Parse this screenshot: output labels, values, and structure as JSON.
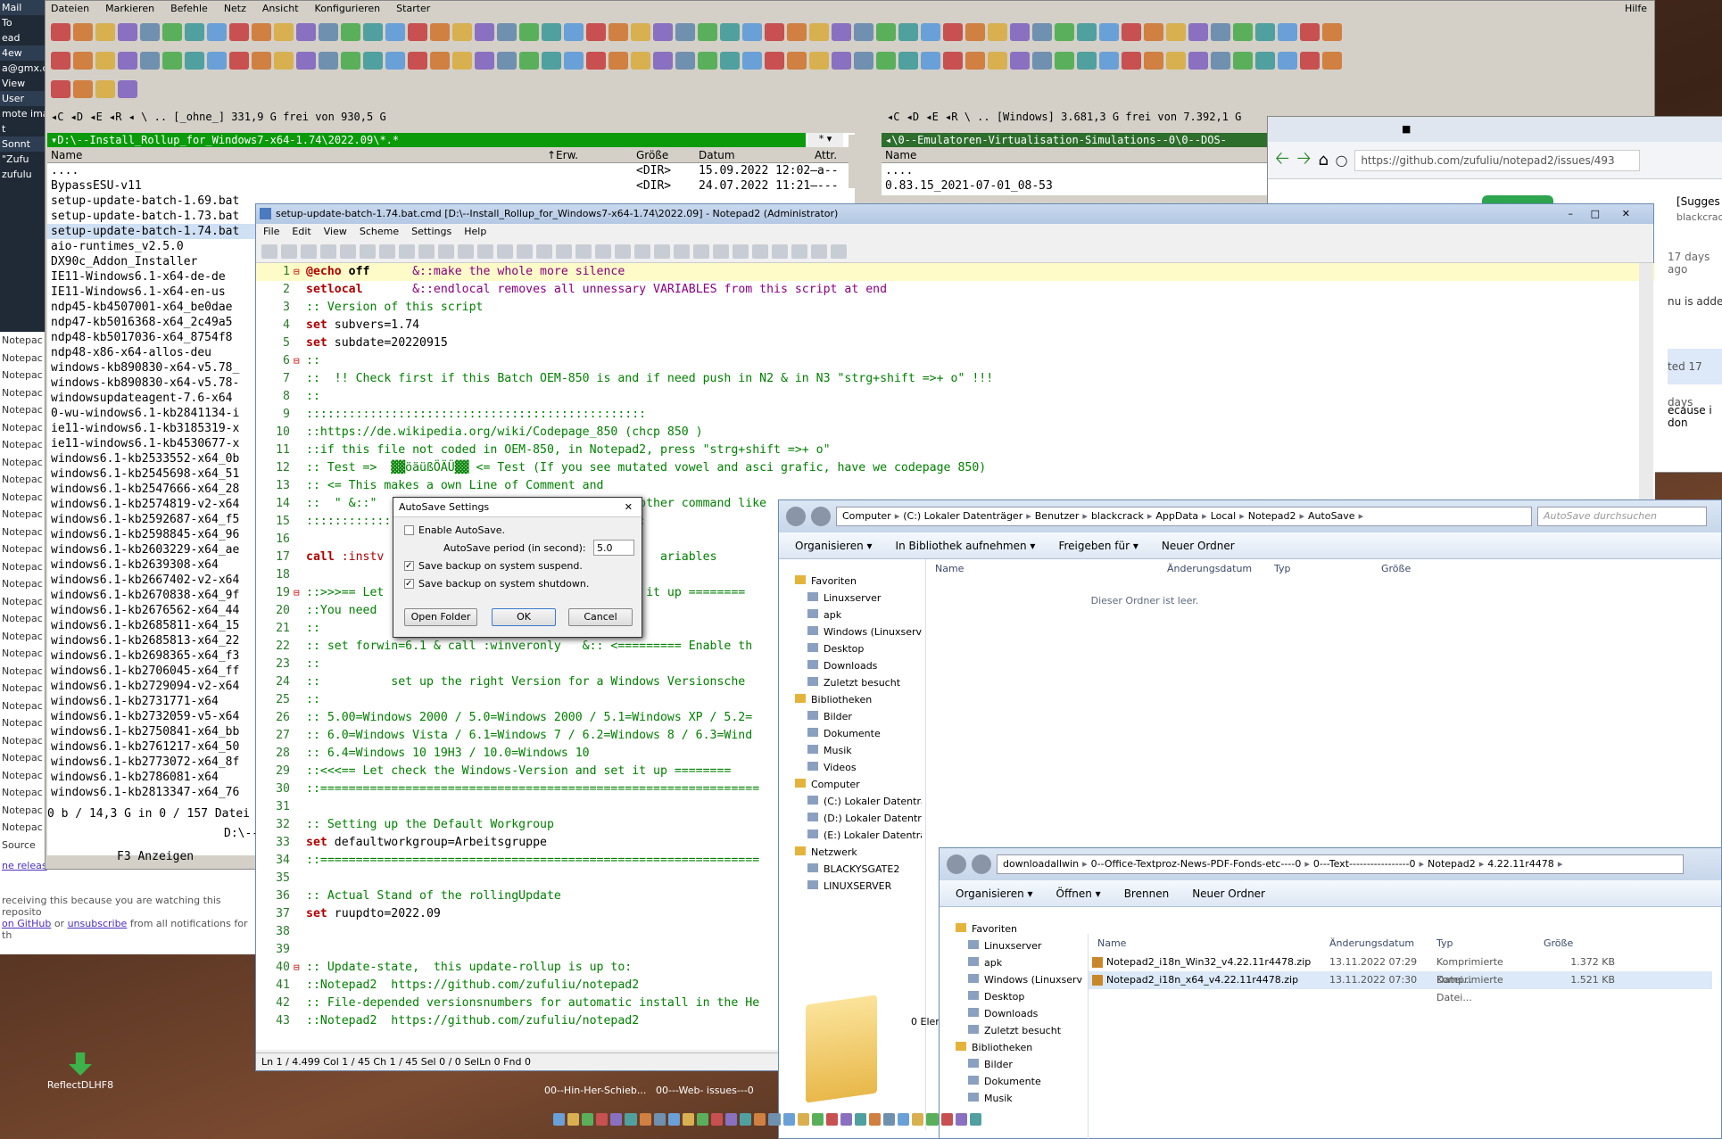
{
  "left_sliver": {
    "items": [
      "Mail",
      "To",
      "ead",
      "4ew",
      "a@gmx.c",
      "View",
      "User",
      "mote ima",
      "t",
      "Sonnt",
      "\"Zufu",
      "zufulu"
    ],
    "notepad_items": [
      "Notepac",
      "Notepac",
      "Notepac",
      "Notepac",
      "Notepac",
      "Notepac",
      "Notepac",
      "Notepac",
      "Notepac",
      "Notepac",
      "Notepac",
      "Notepac",
      "Notepac",
      "Notepac",
      "Notepac",
      "Notepac",
      "Notepac",
      "Notepac",
      "Notepac",
      "Notepac",
      "Notepac",
      "Notepac",
      "Notepac",
      "Notepac",
      "Notepac",
      "Notepac",
      "Notepac",
      "Notepac",
      "Notepac",
      "Source",
      "Source"
    ]
  },
  "tc": {
    "menu": [
      "Dateien",
      "Markieren",
      "Befehle",
      "Netz",
      "Ansicht",
      "Konfigurieren",
      "Starter"
    ],
    "help": "Hilfe",
    "drives_left": "◂C ◂D ◂E ◂R ◂ \\ .. [_ohne_]  331,9 G frei von 930,5 G",
    "drives_right": "◂C ◂D ◂E ◂R \\ .. [Windows]  3.681,3 G frei von 7.392,1 G",
    "left_path": "▾D:\\--Install_Rollup_for_Windows7-x64-1.74\\2022.09\\*.*",
    "left_star": "* ▾",
    "right_path": "◂\\0--Emulatoren-Virtualisation-Simulations--0\\0--DOS-",
    "cols": {
      "name": "Name",
      "ext": "↑Erw.",
      "size": "Größe",
      "date": "Datum",
      "attr": "Attr."
    },
    "left_files": [
      {
        "name": "....",
        "size": "<DIR>",
        "date": "15.09.2022 12:02—a--"
      },
      {
        "name": "BypassESU-v11",
        "size": "<DIR>",
        "date": "24.07.2022 11:21—---"
      },
      {
        "name": "setup-update-batch-1.69.bat",
        "size": "",
        "date": ""
      },
      {
        "name": "setup-update-batch-1.73.bat",
        "size": "",
        "date": ""
      },
      {
        "name": "setup-update-batch-1.74.bat",
        "size": "",
        "date": ""
      },
      {
        "name": "aio-runtimes_v2.5.0",
        "size": "",
        "date": ""
      },
      {
        "name": "DX90c_Addon_Installer",
        "size": "",
        "date": ""
      },
      {
        "name": "IE11-Windows6.1-x64-de-de",
        "size": "",
        "date": ""
      },
      {
        "name": "IE11-Windows6.1-x64-en-us",
        "size": "",
        "date": ""
      },
      {
        "name": "ndp45-kb4507001-x64_be0dae",
        "size": "",
        "date": ""
      },
      {
        "name": "ndp47-kb5016368-x64_2c49a5",
        "size": "",
        "date": ""
      },
      {
        "name": "ndp48-kb5017036-x64_8754f8",
        "size": "",
        "date": ""
      },
      {
        "name": "ndp48-x86-x64-allos-deu",
        "size": "",
        "date": ""
      },
      {
        "name": "windows-kb890830-x64-v5.78_",
        "size": "",
        "date": ""
      },
      {
        "name": "windows-kb890830-x64-v5.78-",
        "size": "",
        "date": ""
      },
      {
        "name": "windowsupdateagent-7.6-x64",
        "size": "",
        "date": ""
      },
      {
        "name": "0-wu-windows6.1-kb2841134-i",
        "size": "",
        "date": ""
      },
      {
        "name": "ie11-windows6.1-kb3185319-x",
        "size": "",
        "date": ""
      },
      {
        "name": "ie11-windows6.1-kb4530677-x",
        "size": "",
        "date": ""
      },
      {
        "name": "windows6.1-kb2533552-x64_0b",
        "size": "",
        "date": ""
      },
      {
        "name": "windows6.1-kb2545698-x64_51",
        "size": "",
        "date": ""
      },
      {
        "name": "windows6.1-kb2547666-x64_28",
        "size": "",
        "date": ""
      },
      {
        "name": "windows6.1-kb2574819-v2-x64",
        "size": "",
        "date": ""
      },
      {
        "name": "windows6.1-kb2592687-x64_f5",
        "size": "",
        "date": ""
      },
      {
        "name": "windows6.1-kb2598845-x64_96",
        "size": "",
        "date": ""
      },
      {
        "name": "windows6.1-kb2603229-x64_ae",
        "size": "",
        "date": ""
      },
      {
        "name": "windows6.1-kb2639308-x64",
        "size": "",
        "date": ""
      },
      {
        "name": "windows6.1-kb2667402-v2-x64",
        "size": "",
        "date": ""
      },
      {
        "name": "windows6.1-kb2670838-x64_9f",
        "size": "",
        "date": ""
      },
      {
        "name": "windows6.1-kb2676562-x64_44",
        "size": "",
        "date": ""
      },
      {
        "name": "windows6.1-kb2685811-x64_15",
        "size": "",
        "date": ""
      },
      {
        "name": "windows6.1-kb2685813-x64_22",
        "size": "",
        "date": ""
      },
      {
        "name": "windows6.1-kb2698365-x64_f3",
        "size": "",
        "date": ""
      },
      {
        "name": "windows6.1-kb2706045-x64_ff",
        "size": "",
        "date": ""
      },
      {
        "name": "windows6.1-kb2729094-v2-x64",
        "size": "",
        "date": ""
      },
      {
        "name": "windows6.1-kb2731771-x64",
        "size": "",
        "date": ""
      },
      {
        "name": "windows6.1-kb2732059-v5-x64",
        "size": "",
        "date": ""
      },
      {
        "name": "windows6.1-kb2750841-x64_bb",
        "size": "",
        "date": ""
      },
      {
        "name": "windows6.1-kb2761217-x64_50",
        "size": "",
        "date": ""
      },
      {
        "name": "windows6.1-kb2773072-x64_8f",
        "size": "",
        "date": ""
      },
      {
        "name": "windows6.1-kb2786081-x64",
        "size": "",
        "date": ""
      },
      {
        "name": "windows6.1-kb2813347-x64_76",
        "size": "",
        "date": ""
      }
    ],
    "right_files": [
      {
        "name": "....",
        "size": "",
        "date": ""
      },
      {
        "name": "0.83.15_2021-07-01_08-53",
        "size": "",
        "date": ""
      }
    ],
    "left_status": "0 b / 14,3 G in 0 / 157 Datei",
    "cmdline": "D:\\--",
    "f3": "F3 Anzeigen"
  },
  "notepad": {
    "title": "setup-update-batch-1.74.bat.cmd [D:\\--Install_Rollup_for_Windows7-x64-1.74\\2022.09] - Notepad2 (Administrator)",
    "menu": [
      "File",
      "Edit",
      "View",
      "Scheme",
      "Settings",
      "Help"
    ],
    "lines": [
      {
        "n": "1",
        "fold": "⊟",
        "parts": [
          {
            "t": "@echo",
            "c": "#b00000",
            "b": true
          },
          {
            "t": " off",
            "c": "#000",
            "b": true
          },
          {
            "t": "      &::make the whole more silence",
            "c": "#8a0080"
          }
        ],
        "hl": true
      },
      {
        "n": "2",
        "parts": [
          {
            "t": "setlocal",
            "c": "#b00000",
            "b": true
          },
          {
            "t": "       &::endlocal removes all unnessary VARIABLES from this script at end",
            "c": "#8a0080"
          }
        ]
      },
      {
        "n": "3",
        "parts": [
          {
            "t": ":: Version of this script",
            "c": "#008000"
          }
        ]
      },
      {
        "n": "4",
        "parts": [
          {
            "t": "set",
            "c": "#b00000",
            "b": true
          },
          {
            "t": " subvers=1.74",
            "c": "#000"
          }
        ]
      },
      {
        "n": "5",
        "parts": [
          {
            "t": "set",
            "c": "#b00000",
            "b": true
          },
          {
            "t": " subdate=20220915",
            "c": "#000"
          }
        ]
      },
      {
        "n": "6",
        "fold": "⊟",
        "parts": [
          {
            "t": "::",
            "c": "#008000"
          }
        ]
      },
      {
        "n": "7",
        "parts": [
          {
            "t": "::  !! Check first if this Batch OEM-850 is and if need push in N2 & in N3 \"strg+shift =>+ o\" !!!",
            "c": "#008000"
          }
        ]
      },
      {
        "n": "8",
        "parts": [
          {
            "t": "::",
            "c": "#008000"
          }
        ]
      },
      {
        "n": "9",
        "parts": [
          {
            "t": "::::::::::::::::::::::::::::::::::::::::::::::::",
            "c": "#008000"
          }
        ]
      },
      {
        "n": "10",
        "parts": [
          {
            "t": "::https://de.wikipedia.org/wiki/Codepage_850 (chcp 850 )",
            "c": "#008000"
          }
        ]
      },
      {
        "n": "11",
        "parts": [
          {
            "t": "::if this file not coded in OEM-850, in Notepad2, press \"strg+shift =>+ o\"",
            "c": "#008000"
          }
        ]
      },
      {
        "n": "12",
        "parts": [
          {
            "t": ":: Test =>  ▓▓öäüßÖÄÜ▓▓ <= Test (If you see mutated vowel and asci grafic, have we codepage 850)",
            "c": "#008000"
          }
        ]
      },
      {
        "n": "13",
        "parts": [
          {
            "t": ":: <= This makes a own Line of Comment and",
            "c": "#008000"
          }
        ]
      },
      {
        "n": "14",
        "parts": [
          {
            "t": "::  \" &::\"                                     other command like",
            "c": "#008000"
          }
        ]
      },
      {
        "n": "15",
        "parts": [
          {
            "t": "::::::::::::::::::::::::::::::::::::::::::::::::",
            "c": "#008000"
          }
        ]
      },
      {
        "n": "16",
        "parts": [
          {
            "t": "",
            "c": "#000"
          }
        ]
      },
      {
        "n": "17",
        "parts": [
          {
            "t": "call",
            "c": "#b00000",
            "b": true
          },
          {
            "t": " :instv",
            "c": "#b00000"
          },
          {
            "t": "                                       ariables",
            "c": "#008000"
          }
        ]
      },
      {
        "n": "18",
        "parts": [
          {
            "t": "",
            "c": "#000"
          }
        ]
      },
      {
        "n": "19",
        "fold": "⊟",
        "parts": [
          {
            "t": "::>>>== Let                                     it up ========",
            "c": "#008000"
          }
        ]
      },
      {
        "n": "20",
        "parts": [
          {
            "t": "::You need",
            "c": "#008000"
          }
        ]
      },
      {
        "n": "21",
        "parts": [
          {
            "t": "::",
            "c": "#008000"
          }
        ]
      },
      {
        "n": "22",
        "parts": [
          {
            "t": ":: set forwin=6.1 & call :winveronly   &:: <========= Enable th",
            "c": "#008000"
          }
        ]
      },
      {
        "n": "23",
        "parts": [
          {
            "t": "::",
            "c": "#008000"
          }
        ]
      },
      {
        "n": "24",
        "parts": [
          {
            "t": "::          set up the right Version for a Windows Versionsche",
            "c": "#008000"
          }
        ]
      },
      {
        "n": "25",
        "parts": [
          {
            "t": "::",
            "c": "#008000"
          }
        ]
      },
      {
        "n": "26",
        "parts": [
          {
            "t": ":: 5.00=Windows 2000 / 5.0=Windows 2000 / 5.1=Windows XP / 5.2=",
            "c": "#008000"
          }
        ]
      },
      {
        "n": "27",
        "parts": [
          {
            "t": ":: 6.0=Windows Vista / 6.1=Windows 7 / 6.2=Windows 8 / 6.3=Wind",
            "c": "#008000"
          }
        ]
      },
      {
        "n": "28",
        "parts": [
          {
            "t": ":: 6.4=Windows 10 19H3 / 10.0=Windows 10",
            "c": "#008000"
          }
        ]
      },
      {
        "n": "29",
        "parts": [
          {
            "t": "::<<<== Let check the Windows-Version and set it up ========",
            "c": "#008000"
          }
        ]
      },
      {
        "n": "30",
        "parts": [
          {
            "t": "::==============================================================",
            "c": "#008000"
          }
        ]
      },
      {
        "n": "31",
        "parts": [
          {
            "t": "",
            "c": "#000"
          }
        ]
      },
      {
        "n": "32",
        "parts": [
          {
            "t": ":: Setting up the Default Workgroup",
            "c": "#008000"
          }
        ]
      },
      {
        "n": "33",
        "parts": [
          {
            "t": "set",
            "c": "#b00000",
            "b": true
          },
          {
            "t": " defaultworkgroup=Arbeitsgruppe",
            "c": "#000"
          }
        ]
      },
      {
        "n": "34",
        "parts": [
          {
            "t": "::==============================================================",
            "c": "#008000"
          }
        ]
      },
      {
        "n": "35",
        "parts": [
          {
            "t": "",
            "c": "#000"
          }
        ]
      },
      {
        "n": "36",
        "parts": [
          {
            "t": ":: Actual Stand of the rollingUpdate",
            "c": "#008000"
          }
        ]
      },
      {
        "n": "37",
        "parts": [
          {
            "t": "set",
            "c": "#b00000",
            "b": true
          },
          {
            "t": " ruupdto=2022.09",
            "c": "#000"
          }
        ]
      },
      {
        "n": "38",
        "parts": [
          {
            "t": "",
            "c": "#000"
          }
        ]
      },
      {
        "n": "39",
        "parts": [
          {
            "t": "",
            "c": "#000"
          }
        ]
      },
      {
        "n": "40",
        "fold": "⊟",
        "parts": [
          {
            "t": ":: Update-state,  this update-rollup is up to:",
            "c": "#008000"
          }
        ]
      },
      {
        "n": "41",
        "parts": [
          {
            "t": "::Notepad2  https://github.com/zufuliu/notepad2",
            "c": "#008000"
          }
        ]
      },
      {
        "n": "42",
        "parts": [
          {
            "t": ":: File-depended versionsnumbers for automatic install in the He",
            "c": "#008000"
          }
        ]
      },
      {
        "n": "43",
        "parts": [
          {
            "t": "::Notepad2  https://github.com/zufuliu/notepad2",
            "c": "#008000"
          }
        ]
      }
    ],
    "status": "Ln 1 / 4.499  Col 1 / 45  Ch 1 / 45  Sel 0 / 0  SelLn 0  Fnd 0"
  },
  "autosave": {
    "title": "AutoSave Settings",
    "enable": "Enable AutoSave.",
    "period_label": "AutoSave period (in second):",
    "period_value": "5.0",
    "suspend": "Save backup on system suspend.",
    "shutdown": "Save backup on system shutdown.",
    "open_folder": "Open Folder",
    "ok": "OK",
    "cancel": "Cancel"
  },
  "explorer1": {
    "crumbs": [
      "Computer",
      "(C:) Lokaler Datenträger",
      "Benutzer",
      "blackcrack",
      "AppData",
      "Local",
      "Notepad2",
      "AutoSave"
    ],
    "search": "AutoSave durchsuchen",
    "cmds": [
      "Organisieren ▾",
      "In Bibliothek aufnehmen ▾",
      "Freigeben für ▾",
      "Neuer Ordner"
    ],
    "cols": [
      "Name",
      "Änderungsdatum",
      "Typ",
      "Größe"
    ],
    "empty": "Dieser Ordner ist leer.",
    "nav": [
      {
        "t": "Favoriten",
        "h": true
      },
      {
        "t": "Linuxserver"
      },
      {
        "t": "apk"
      },
      {
        "t": "Windows (Linuxserve"
      },
      {
        "t": "Desktop"
      },
      {
        "t": "Downloads"
      },
      {
        "t": "Zuletzt besucht"
      },
      {
        "t": ""
      },
      {
        "t": "Bibliotheken",
        "h": true
      },
      {
        "t": "Bilder"
      },
      {
        "t": "Dokumente"
      },
      {
        "t": "Musik"
      },
      {
        "t": "Videos"
      },
      {
        "t": ""
      },
      {
        "t": "Computer",
        "h": true
      },
      {
        "t": "(C:) Lokaler Datenträ"
      },
      {
        "t": "(D:) Lokaler Datenträ"
      },
      {
        "t": "(E:) Lokaler Datenträg"
      },
      {
        "t": ""
      },
      {
        "t": "Netzwerk",
        "h": true
      },
      {
        "t": "BLACKYSGATE2"
      },
      {
        "t": "LINUXSERVER"
      }
    ],
    "count": "0 Elem"
  },
  "explorer2": {
    "crumbs": [
      "downloadallwin",
      "0--Office-Textproz-News-PDF-Fonds-etc----0",
      "0---Text-----------------0",
      "Notepad2",
      "4.22.11r4478"
    ],
    "cmds": [
      "Organisieren ▾",
      "Öffnen ▾",
      "Brennen",
      "Neuer Ordner"
    ],
    "cols": [
      "Name",
      "Änderungsdatum",
      "Typ",
      "Größe"
    ],
    "files": [
      {
        "name": "Notepad2_i18n_Win32_v4.22.11r4478.zip",
        "date": "13.11.2022 07:29",
        "type": "Komprimierte Datei...",
        "size": "1.372 KB"
      },
      {
        "name": "Notepad2_i18n_x64_v4.22.11r4478.zip",
        "date": "13.11.2022 07:30",
        "type": "Komprimierte Datei...",
        "size": "1.521 KB"
      }
    ],
    "nav": [
      {
        "t": "Favoriten",
        "h": true
      },
      {
        "t": "Linuxserver"
      },
      {
        "t": "apk"
      },
      {
        "t": "Windows (Linuxserve"
      },
      {
        "t": "Desktop"
      },
      {
        "t": "Downloads"
      },
      {
        "t": "Zuletzt besucht"
      },
      {
        "t": ""
      },
      {
        "t": "Bibliotheken",
        "h": true
      },
      {
        "t": "Bilder"
      },
      {
        "t": "Dokumente"
      },
      {
        "t": "Musik"
      }
    ]
  },
  "browser": {
    "url": "https://github.com/zufuliu/notepad2/issues/493",
    "suggest": "[Sugges",
    "user": "blackcrac",
    "snips": [
      "17 days ago",
      "nu is added",
      "ted 17 days",
      "ecause i don"
    ]
  },
  "github_footer": {
    "release": "ne releas",
    "line1": "receiving this because you are watching this reposito",
    "line2_a": "on GitHub",
    "line2_b": " or ",
    "line2_c": "unsubscribe",
    "line2_d": " from all notifications for th"
  },
  "desktop": {
    "icon_label": "ReflectDLHF8",
    "task1": "00--Hin-Her-Schieb...",
    "task2": "00---Web- issues---0"
  }
}
